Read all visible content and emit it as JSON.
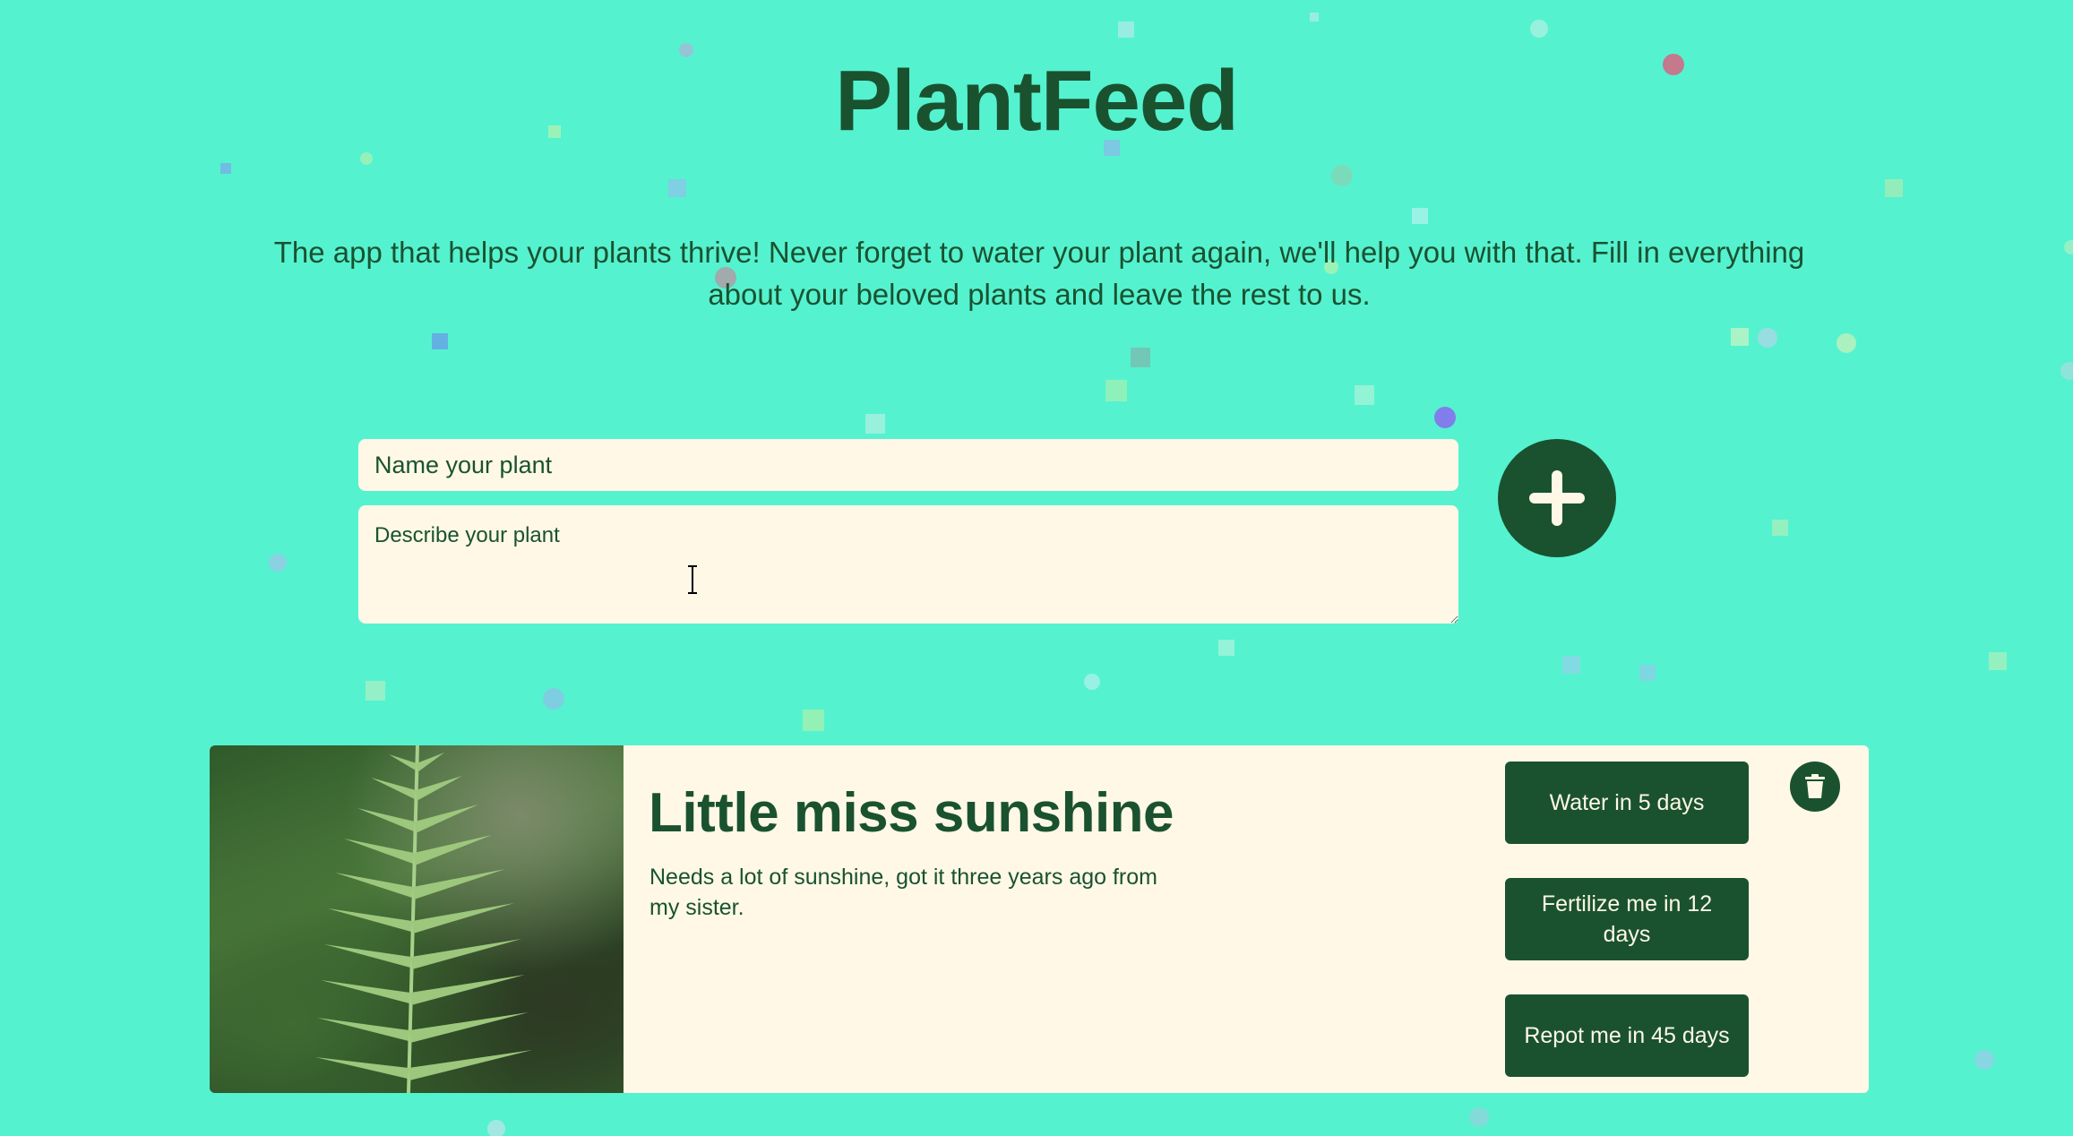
{
  "app": {
    "title": "PlantFeed",
    "tagline": "The app that helps your plants thrive! Never forget to water your plant again, we'll help you with that. Fill in everything about your beloved plants and leave the rest to us."
  },
  "form": {
    "name_placeholder": "Name your plant",
    "description_placeholder": "Describe your plant",
    "add_icon": "plus-icon"
  },
  "plants": [
    {
      "name": "Little miss sunshine",
      "description": "Needs a lot of sunshine, got it three years ago from my sister.",
      "image_icon": "fern-photo",
      "water_label": "Water in 5 days",
      "fertilize_label": "Fertilize me in 12 days",
      "repot_label": "Repot me in 45 days",
      "delete_icon": "trash-icon"
    }
  ],
  "colors": {
    "background": "#55f2d0",
    "accent": "#1a5230",
    "card": "#fff8e6"
  }
}
